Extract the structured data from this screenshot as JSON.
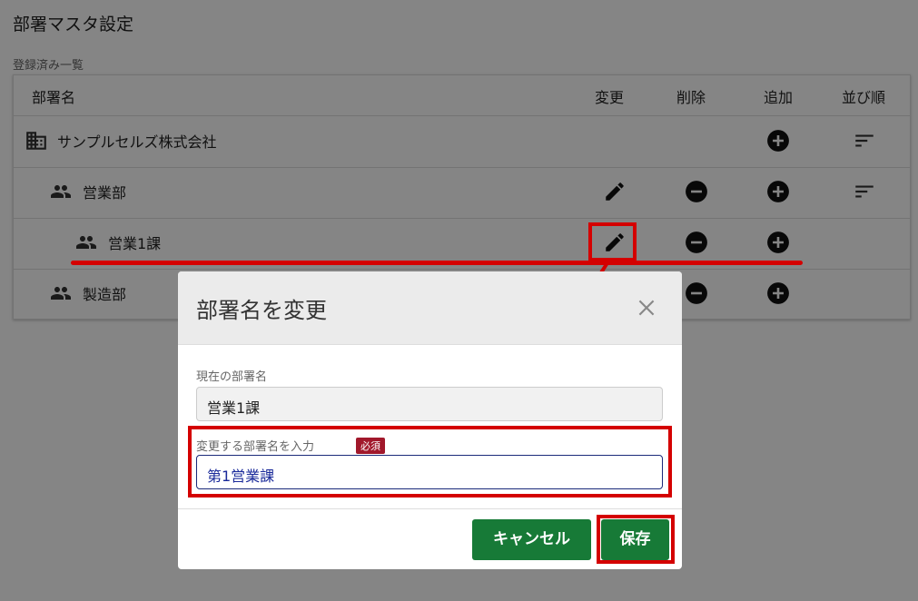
{
  "page": {
    "title": "部署マスタ設定",
    "list_caption": "登録済み一覧"
  },
  "table": {
    "headers": {
      "name": "部署名",
      "edit": "変更",
      "delete": "削除",
      "add": "追加",
      "order": "並び順"
    },
    "rows": [
      {
        "name": "サンプルセルズ株式会社",
        "icon": "building-icon",
        "edit": false,
        "delete": false,
        "add": true,
        "order": true
      },
      {
        "name": "営業部",
        "icon": "group-icon",
        "edit": true,
        "delete": true,
        "add": true,
        "order": true
      },
      {
        "name": "営業1課",
        "icon": "group-icon",
        "edit": true,
        "delete": true,
        "add": true,
        "order": false
      },
      {
        "name": "製造部",
        "icon": "group-icon",
        "edit": false,
        "delete": true,
        "add": true,
        "order": false
      }
    ]
  },
  "modal": {
    "title": "部署名を変更",
    "current_label": "現在の部署名",
    "current_value": "営業1課",
    "new_label": "変更する部署名を入力",
    "required_badge": "必須",
    "new_value": "第1営業課",
    "cancel_label": "キャンセル",
    "save_label": "保存"
  },
  "colors": {
    "accent_green": "#177a37",
    "highlight_red": "#d40000",
    "required_badge": "#a1182b"
  }
}
